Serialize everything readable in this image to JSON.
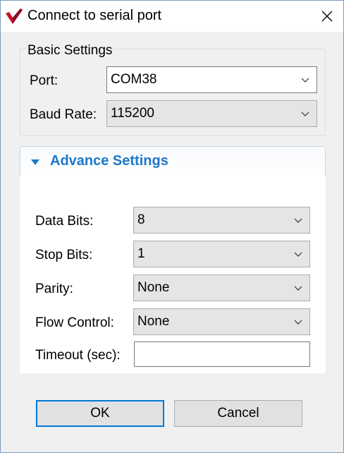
{
  "window": {
    "title": "Connect to serial port",
    "app_icon": "red-checkmark-icon",
    "close_icon": "close-icon"
  },
  "basic": {
    "title": "Basic Settings",
    "port_label": "Port:",
    "port_value": "COM38",
    "baud_label": "Baud Rate:",
    "baud_value": "115200"
  },
  "advance": {
    "title": "Advance Settings",
    "expanded": true,
    "accent_color": "#1e78c9",
    "data_bits_label": "Data Bits:",
    "data_bits_value": "8",
    "stop_bits_label": "Stop Bits:",
    "stop_bits_value": "1",
    "parity_label": "Parity:",
    "parity_value": "None",
    "flow_label": "Flow Control:",
    "flow_value": "None",
    "timeout_label": "Timeout (sec):",
    "timeout_value": ""
  },
  "buttons": {
    "ok": "OK",
    "cancel": "Cancel"
  }
}
